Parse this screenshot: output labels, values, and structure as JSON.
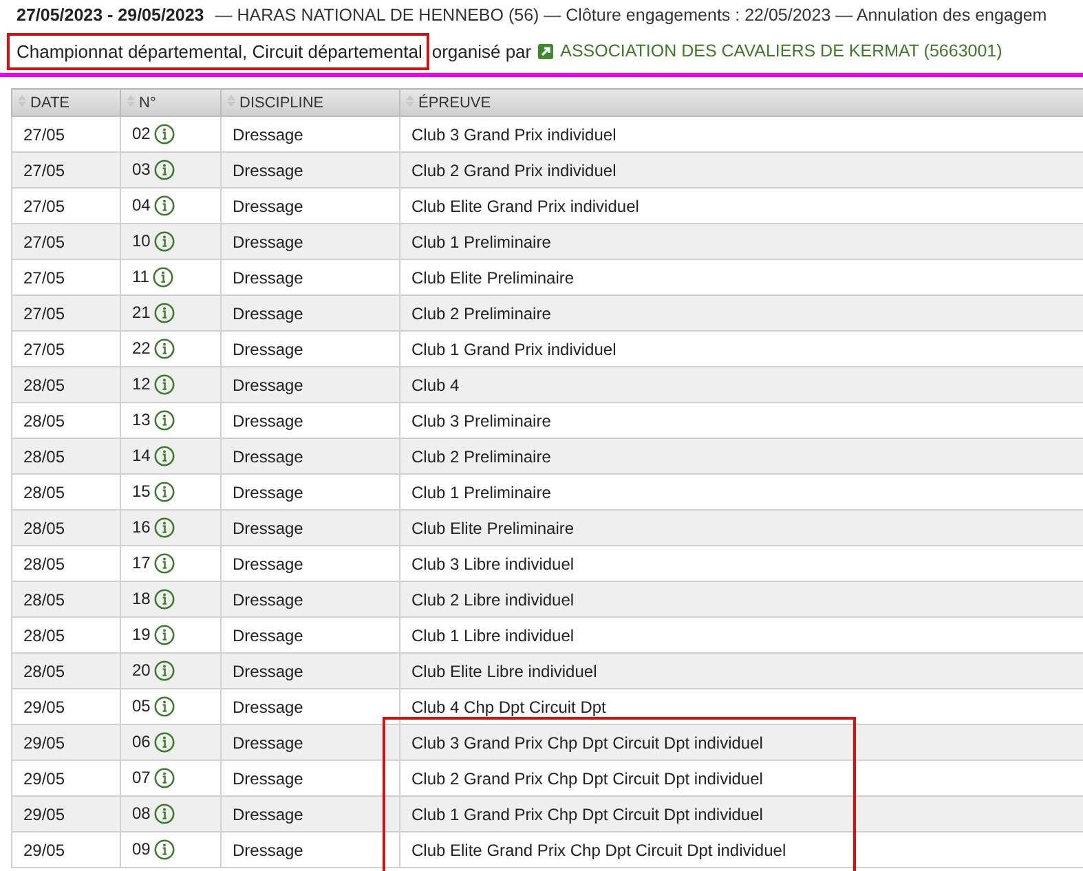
{
  "header": {
    "dates": "27/05/2023 - 29/05/2023",
    "details": "— HARAS NATIONAL DE HENNEBO (56)  — Clôture engagements : 22/05/2023 — Annulation des engagem",
    "category": "Championnat départemental, Circuit départemental",
    "category_highlighted": true,
    "organizer_label": "organisé par",
    "organizer": "ASSOCIATION DES CAVALIERS DE KERMAT (5663001)"
  },
  "table": {
    "columns": [
      "DATE",
      "N°",
      "DISCIPLINE",
      "ÉPREUVE"
    ],
    "rows": [
      {
        "date": "27/05",
        "number": "02",
        "discipline": "Dressage",
        "event": "Club 3 Grand Prix individuel",
        "highlighted": false
      },
      {
        "date": "27/05",
        "number": "03",
        "discipline": "Dressage",
        "event": "Club 2 Grand Prix individuel",
        "highlighted": false
      },
      {
        "date": "27/05",
        "number": "04",
        "discipline": "Dressage",
        "event": "Club Elite Grand Prix individuel",
        "highlighted": false
      },
      {
        "date": "27/05",
        "number": "10",
        "discipline": "Dressage",
        "event": "Club 1 Preliminaire",
        "highlighted": false
      },
      {
        "date": "27/05",
        "number": "11",
        "discipline": "Dressage",
        "event": "Club Elite Preliminaire",
        "highlighted": false
      },
      {
        "date": "27/05",
        "number": "21",
        "discipline": "Dressage",
        "event": "Club 2 Preliminaire",
        "highlighted": false
      },
      {
        "date": "27/05",
        "number": "22",
        "discipline": "Dressage",
        "event": "Club 1 Grand Prix individuel",
        "highlighted": false
      },
      {
        "date": "28/05",
        "number": "12",
        "discipline": "Dressage",
        "event": "Club 4",
        "highlighted": false
      },
      {
        "date": "28/05",
        "number": "13",
        "discipline": "Dressage",
        "event": "Club 3 Preliminaire",
        "highlighted": false
      },
      {
        "date": "28/05",
        "number": "14",
        "discipline": "Dressage",
        "event": "Club 2 Preliminaire",
        "highlighted": false
      },
      {
        "date": "28/05",
        "number": "15",
        "discipline": "Dressage",
        "event": "Club 1 Preliminaire",
        "highlighted": false
      },
      {
        "date": "28/05",
        "number": "16",
        "discipline": "Dressage",
        "event": "Club Elite Preliminaire",
        "highlighted": false
      },
      {
        "date": "28/05",
        "number": "17",
        "discipline": "Dressage",
        "event": "Club 3 Libre individuel",
        "highlighted": false
      },
      {
        "date": "28/05",
        "number": "18",
        "discipline": "Dressage",
        "event": "Club 2 Libre individuel",
        "highlighted": false
      },
      {
        "date": "28/05",
        "number": "19",
        "discipline": "Dressage",
        "event": "Club 1 Libre individuel",
        "highlighted": false
      },
      {
        "date": "28/05",
        "number": "20",
        "discipline": "Dressage",
        "event": "Club Elite Libre individuel",
        "highlighted": false
      },
      {
        "date": "29/05",
        "number": "05",
        "discipline": "Dressage",
        "event": "Club 4 Chp Dpt Circuit Dpt",
        "highlighted": false
      },
      {
        "date": "29/05",
        "number": "06",
        "discipline": "Dressage",
        "event": "Club 3 Grand Prix Chp Dpt Circuit Dpt individuel",
        "highlighted": true
      },
      {
        "date": "29/05",
        "number": "07",
        "discipline": "Dressage",
        "event": "Club 2 Grand Prix Chp Dpt Circuit Dpt individuel",
        "highlighted": true
      },
      {
        "date": "29/05",
        "number": "08",
        "discipline": "Dressage",
        "event": "Club 1 Grand Prix Chp Dpt Circuit Dpt individuel",
        "highlighted": true
      },
      {
        "date": "29/05",
        "number": "09",
        "discipline": "Dressage",
        "event": "Club Elite Grand Prix Chp Dpt Circuit Dpt individuel",
        "highlighted": true
      }
    ]
  }
}
